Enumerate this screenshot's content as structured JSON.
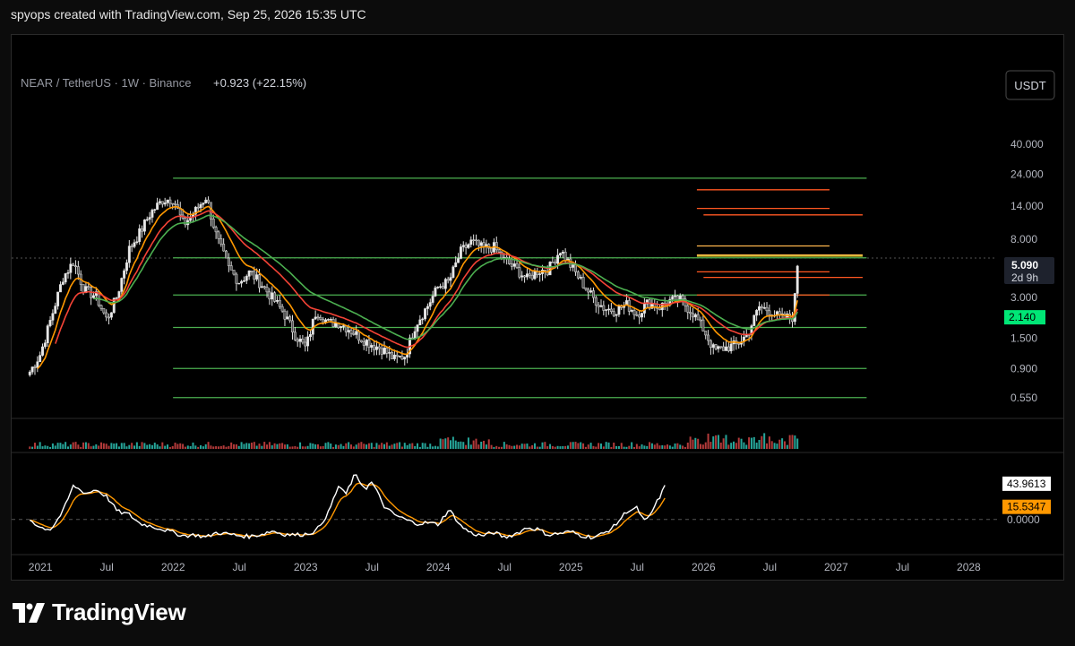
{
  "header": {
    "text": "spyops created with TradingView.com, Sep 25, 2026 15:35 UTC"
  },
  "brand": {
    "name": "TradingView"
  },
  "icons": {
    "brand_logo": "tradingview-logo-icon"
  },
  "chart_data": {
    "type": "candlestick",
    "symbol_line": {
      "pair": "NEAR / TetherUS",
      "interval": "1W",
      "exchange": "Binance",
      "change": "+0.923 (+22.15%)"
    },
    "currency_button": "USDT",
    "y_scale": "log",
    "ylim": [
      0.45,
      70
    ],
    "x_ticks": [
      {
        "label": "2021",
        "t": 2021.0
      },
      {
        "label": "Jul",
        "t": 2021.5
      },
      {
        "label": "2022",
        "t": 2022.0
      },
      {
        "label": "Jul",
        "t": 2022.5
      },
      {
        "label": "2023",
        "t": 2023.0
      },
      {
        "label": "Jul",
        "t": 2023.5
      },
      {
        "label": "2024",
        "t": 2024.0
      },
      {
        "label": "Jul",
        "t": 2024.5
      },
      {
        "label": "2025",
        "t": 2025.0
      },
      {
        "label": "Jul",
        "t": 2025.5
      },
      {
        "label": "2026",
        "t": 2026.0
      },
      {
        "label": "Jul",
        "t": 2026.5
      },
      {
        "label": "2027",
        "t": 2027.0
      },
      {
        "label": "Jul",
        "t": 2027.5
      },
      {
        "label": "2028",
        "t": 2028.0
      }
    ],
    "y_ticks": [
      "40.000",
      "24.000",
      "14.000",
      "8.000",
      "3.000",
      "1.500",
      "0.900",
      "0.550"
    ],
    "y_tick_values": [
      40,
      24,
      14,
      8,
      3,
      1.5,
      0.9,
      0.55
    ],
    "last_price": {
      "label": "5.090",
      "value": 5.09,
      "countdown": "2d 9h"
    },
    "ma_label": {
      "label": "2.140",
      "value": 2.14
    },
    "horizontal_levels": [
      22.5,
      5.85,
      3.12,
      1.8,
      0.9,
      0.55
    ],
    "horizontal_levels_x_range": [
      2022.0,
      2027.23
    ],
    "target_lines": [
      {
        "price": 18.5,
        "t0": 2025.95,
        "t1": 2026.95,
        "color": "#ff5722"
      },
      {
        "price": 13.5,
        "t0": 2025.95,
        "t1": 2026.95,
        "color": "#ff5722"
      },
      {
        "price": 12.1,
        "t0": 2026.0,
        "t1": 2027.2,
        "color": "#ff5722"
      },
      {
        "price": 7.15,
        "t0": 2025.95,
        "t1": 2026.95,
        "color": "#ffb74d"
      },
      {
        "price": 6.15,
        "t0": 2025.95,
        "t1": 2027.2,
        "color": "#ffb74d"
      },
      {
        "price": 6.02,
        "t0": 2025.95,
        "t1": 2027.2,
        "color": "#ffeb3b"
      },
      {
        "price": 4.62,
        "t0": 2025.95,
        "t1": 2026.95,
        "color": "#ff5722"
      },
      {
        "price": 4.2,
        "t0": 2026.0,
        "t1": 2027.2,
        "color": "#ff5722"
      },
      {
        "price": 3.12,
        "t0": 2025.95,
        "t1": 2026.95,
        "color": "#ff5722"
      }
    ],
    "price_anchors": [
      [
        2020.92,
        0.85
      ],
      [
        2021.0,
        1.15
      ],
      [
        2021.08,
        2.1
      ],
      [
        2021.17,
        4.2
      ],
      [
        2021.25,
        5.5
      ],
      [
        2021.33,
        3.4
      ],
      [
        2021.42,
        3.05
      ],
      [
        2021.5,
        2.05
      ],
      [
        2021.58,
        3.1
      ],
      [
        2021.67,
        6.8
      ],
      [
        2021.75,
        9.0
      ],
      [
        2021.83,
        12.5
      ],
      [
        2021.92,
        15.5
      ],
      [
        2022.0,
        16.0
      ],
      [
        2022.08,
        10.2
      ],
      [
        2022.17,
        13.0
      ],
      [
        2022.25,
        16.5
      ],
      [
        2022.33,
        8.2
      ],
      [
        2022.42,
        4.9
      ],
      [
        2022.5,
        3.9
      ],
      [
        2022.58,
        4.6
      ],
      [
        2022.67,
        3.7
      ],
      [
        2022.75,
        2.95
      ],
      [
        2022.83,
        2.35
      ],
      [
        2022.92,
        1.6
      ],
      [
        2023.0,
        1.27
      ],
      [
        2023.08,
        2.4
      ],
      [
        2023.17,
        1.95
      ],
      [
        2023.25,
        1.95
      ],
      [
        2023.33,
        1.75
      ],
      [
        2023.42,
        1.5
      ],
      [
        2023.5,
        1.35
      ],
      [
        2023.58,
        1.25
      ],
      [
        2023.67,
        1.05
      ],
      [
        2023.75,
        1.12
      ],
      [
        2023.83,
        1.9
      ],
      [
        2023.92,
        2.6
      ],
      [
        2024.0,
        3.6
      ],
      [
        2024.08,
        3.9
      ],
      [
        2024.17,
        6.5
      ],
      [
        2024.25,
        7.7
      ],
      [
        2024.33,
        6.9
      ],
      [
        2024.42,
        7.0
      ],
      [
        2024.5,
        5.6
      ],
      [
        2024.58,
        4.9
      ],
      [
        2024.67,
        4.1
      ],
      [
        2024.75,
        4.7
      ],
      [
        2024.83,
        4.8
      ],
      [
        2024.92,
        6.7
      ],
      [
        2025.0,
        5.1
      ],
      [
        2025.08,
        3.9
      ],
      [
        2025.17,
        2.95
      ],
      [
        2025.25,
        2.5
      ],
      [
        2025.33,
        2.4
      ],
      [
        2025.42,
        2.65
      ],
      [
        2025.5,
        2.25
      ],
      [
        2025.58,
        2.75
      ],
      [
        2025.67,
        2.55
      ],
      [
        2025.75,
        2.85
      ],
      [
        2025.83,
        2.85
      ],
      [
        2025.92,
        2.3
      ],
      [
        2026.0,
        1.75
      ],
      [
        2026.08,
        1.22
      ],
      [
        2026.17,
        1.28
      ],
      [
        2026.25,
        1.35
      ],
      [
        2026.33,
        1.6
      ],
      [
        2026.42,
        2.55
      ],
      [
        2026.5,
        2.4
      ],
      [
        2026.58,
        2.1
      ],
      [
        2026.67,
        2.15
      ],
      [
        2026.72,
        5.09
      ]
    ],
    "volume": {
      "description": "weekly volume bars, mostly low with spikes"
    },
    "oscillator": {
      "values": [
        {
          "label": "43.9613",
          "value": 43.9613,
          "color": "#ffffff"
        },
        {
          "label": "15.5347",
          "value": 15.5347,
          "color": "#ff9800"
        },
        {
          "label": "0.0000",
          "value": 0.0,
          "color": "#787b86"
        }
      ],
      "ylim": [
        -30,
        78
      ],
      "series_anchors": [
        [
          2020.92,
          0
        ],
        [
          2021.0,
          -10
        ],
        [
          2021.08,
          -12
        ],
        [
          2021.17,
          10
        ],
        [
          2021.25,
          42
        ],
        [
          2021.3,
          36
        ],
        [
          2021.35,
          32
        ],
        [
          2021.42,
          37
        ],
        [
          2021.5,
          28
        ],
        [
          2021.58,
          10
        ],
        [
          2021.67,
          6
        ],
        [
          2021.75,
          -5
        ],
        [
          2021.83,
          -8
        ],
        [
          2021.92,
          -12
        ],
        [
          2022.0,
          -16
        ],
        [
          2022.08,
          -20
        ],
        [
          2022.17,
          -19
        ],
        [
          2022.25,
          -22
        ],
        [
          2022.33,
          -16
        ],
        [
          2022.42,
          -18
        ],
        [
          2022.5,
          -20
        ],
        [
          2022.58,
          -21
        ],
        [
          2022.67,
          -18
        ],
        [
          2022.75,
          -14
        ],
        [
          2022.83,
          -18
        ],
        [
          2022.92,
          -19
        ],
        [
          2023.0,
          -18
        ],
        [
          2023.08,
          -14
        ],
        [
          2023.17,
          8
        ],
        [
          2023.25,
          42
        ],
        [
          2023.3,
          30
        ],
        [
          2023.37,
          55
        ],
        [
          2023.45,
          38
        ],
        [
          2023.5,
          46
        ],
        [
          2023.55,
          30
        ],
        [
          2023.6,
          14
        ],
        [
          2023.67,
          6
        ],
        [
          2023.75,
          0
        ],
        [
          2023.83,
          -5
        ],
        [
          2023.92,
          -4
        ],
        [
          2024.0,
          -6
        ],
        [
          2024.08,
          12
        ],
        [
          2024.12,
          4
        ],
        [
          2024.17,
          -8
        ],
        [
          2024.25,
          -17
        ],
        [
          2024.33,
          -20
        ],
        [
          2024.42,
          -16
        ],
        [
          2024.5,
          -22
        ],
        [
          2024.58,
          -18
        ],
        [
          2024.67,
          -10
        ],
        [
          2024.75,
          -12
        ],
        [
          2024.83,
          -19
        ],
        [
          2024.92,
          -17
        ],
        [
          2025.0,
          -15
        ],
        [
          2025.08,
          -20
        ],
        [
          2025.17,
          -22
        ],
        [
          2025.25,
          -17
        ],
        [
          2025.33,
          -8
        ],
        [
          2025.42,
          10
        ],
        [
          2025.5,
          14
        ],
        [
          2025.55,
          -2
        ],
        [
          2025.58,
          0
        ],
        [
          2025.67,
          28
        ],
        [
          2025.72,
          44
        ]
      ]
    }
  }
}
